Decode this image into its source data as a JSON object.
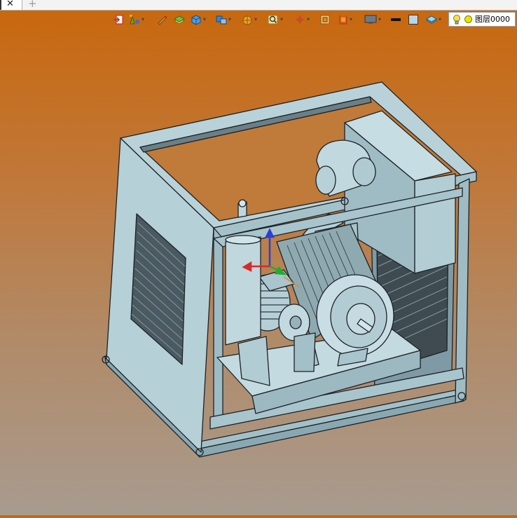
{
  "tabbar": {
    "close_glyph": "✕",
    "add_glyph": "+"
  },
  "toolbar": {
    "tools": [
      {
        "name": "exit-sketch-icon",
        "has_menu": false
      },
      {
        "name": "smart-tool-icon",
        "has_menu": true
      },
      {
        "name": "pencil-icon",
        "has_menu": false
      },
      {
        "name": "feature-icon",
        "has_menu": false
      },
      {
        "name": "solid-box-icon",
        "has_menu": true
      },
      {
        "name": "assembly-icon",
        "has_menu": true
      },
      {
        "name": "surface-icon",
        "has_menu": true
      },
      {
        "name": "zoom-view-icon",
        "has_menu": true
      },
      {
        "name": "triad-icon",
        "has_menu": true
      },
      {
        "name": "measure-icon",
        "has_menu": false
      },
      {
        "name": "section-icon",
        "has_menu": true
      },
      {
        "name": "display-icon",
        "has_menu": true
      },
      {
        "name": "line-style-icon",
        "has_menu": false
      },
      {
        "name": "color-swatch-icon",
        "has_menu": false
      },
      {
        "name": "layer-stack-icon",
        "has_menu": true
      }
    ]
  },
  "layer_selector": {
    "label": "图层0000",
    "colors": {
      "bulb": "#f4e04a",
      "sun": "#e6e600"
    }
  },
  "viewport": {
    "background_top": "#c9670c",
    "background_bottom": "#a89b8f",
    "model_color": "#b8d4db"
  }
}
